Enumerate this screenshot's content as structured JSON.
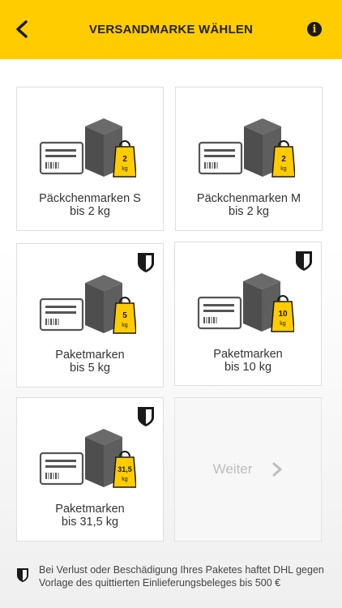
{
  "header": {
    "title": "VERSANDMARKE WÄHLEN",
    "back_icon": "chevron-left-icon",
    "info_icon": "info-icon",
    "info_glyph": "i"
  },
  "tiles": [
    {
      "name_line": "Päckchenmarken S",
      "weight_line": "bis 2 kg",
      "tag_value": "2",
      "tag_unit": "kg",
      "insured": false
    },
    {
      "name_line": "Päckchenmarken M",
      "weight_line": "bis 2 kg",
      "tag_value": "2",
      "tag_unit": "kg",
      "insured": false
    },
    {
      "name_line": "Paketmarken",
      "weight_line": "bis 5 kg",
      "tag_value": "5",
      "tag_unit": "kg",
      "insured": true
    },
    {
      "name_line": "Paketmarken",
      "weight_line": "bis 10 kg",
      "tag_value": "10",
      "tag_unit": "kg",
      "insured": true
    },
    {
      "name_line": "Paketmarken",
      "weight_line": "bis 31,5 kg",
      "tag_value": "31,5",
      "tag_unit": "kg",
      "insured": true
    }
  ],
  "next_tile": {
    "label": "Weiter",
    "icon": "chevron-right-icon"
  },
  "footer": {
    "icon": "shield-icon",
    "text": "Bei Verlust oder Beschädigung Ihres Paketes haftet DHL gegen Vorlage des quittierten Einlieferungsbeleges bis 500 €"
  },
  "colors": {
    "accent": "#ffcc00",
    "box": "#5a5a5a",
    "disabled_text": "#bdbdbd"
  }
}
